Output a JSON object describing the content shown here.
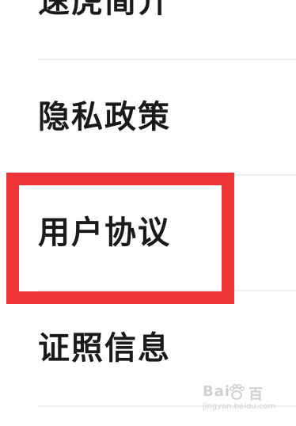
{
  "menu": {
    "items": [
      {
        "label": "速虎简介"
      },
      {
        "label": "隐私政策"
      },
      {
        "label": "用户协议"
      },
      {
        "label": "证照信息"
      }
    ]
  },
  "highlight": {
    "target": "用户协议",
    "color": "#ee3438"
  },
  "watermark": {
    "brand": "Bai",
    "brand_suffix": "百",
    "url": "jingyan.baidu.com"
  }
}
